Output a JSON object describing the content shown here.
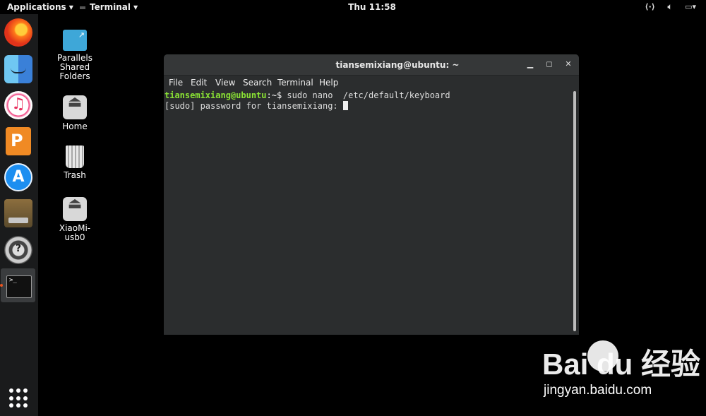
{
  "topbar": {
    "applications": "Applications",
    "active_app": "Terminal",
    "clock": "Thu 11:58"
  },
  "dock": {
    "items": [
      "firefox-icon",
      "finder-icon",
      "itunes-icon",
      "pages-icon",
      "appstore-icon",
      "installer-icon",
      "help-icon",
      "terminal-icon"
    ],
    "terminal_glyph": ">_"
  },
  "desktop": {
    "icons": [
      {
        "label": "Parallels Shared Folders"
      },
      {
        "label": "Home"
      },
      {
        "label": "Trash"
      },
      {
        "label": "XiaoMi-usb0"
      }
    ]
  },
  "window": {
    "title": "tiansemixiang@ubuntu: ~",
    "menu": [
      "File",
      "Edit",
      "View",
      "Search",
      "Terminal",
      "Help"
    ],
    "terminal": {
      "prompt_user": "tiansemixiang@ubuntu",
      "prompt_path": ":~$ ",
      "command": "sudo nano  /etc/default/keyboard",
      "line2": "[sudo] password for tiansemixiang: "
    }
  },
  "watermark": {
    "logo": "Bai du 经验",
    "url": "jingyan.baidu.com"
  }
}
